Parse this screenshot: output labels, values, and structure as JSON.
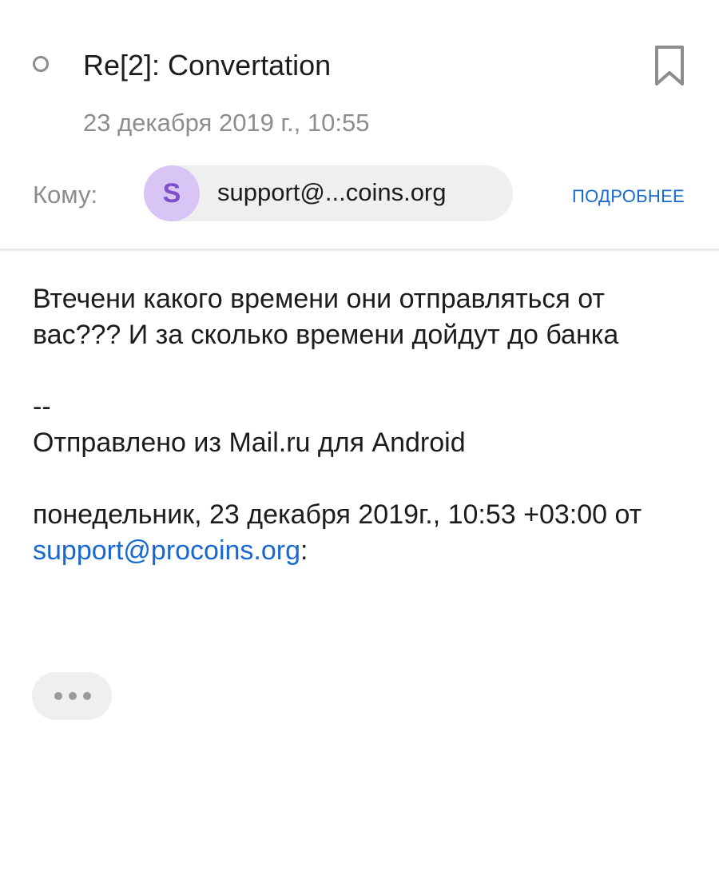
{
  "email": {
    "subject": "Re[2]: Convertation",
    "date": "23 декабря 2019 г., 10:55",
    "to_label": "Кому:",
    "recipient": {
      "avatar_letter": "S",
      "display": "support@...coins.org"
    },
    "more_label": "ПОДРОБНЕЕ"
  },
  "body": {
    "message": "Втечени какого времени они отправляться от вас??? И за сколько времени дойдут до банка",
    "signature_separator": "--",
    "signature": "Отправлено из Mail.ru для Android",
    "quote_header_prefix": "понедельник, 23 декабря 2019г., 10:53 +03:00 от ",
    "quote_email": "support@procoins.org",
    "quote_header_suffix": ":"
  },
  "icons": {
    "unread": "circle-outline-icon",
    "bookmark": "bookmark-icon",
    "expand": "more-horizontal-icon"
  },
  "colors": {
    "accent": "#1769d1",
    "avatar_bg": "#d8c5f5",
    "avatar_fg": "#7d50c8",
    "muted_text": "#8d8d8d",
    "chip_bg": "#efefef"
  }
}
